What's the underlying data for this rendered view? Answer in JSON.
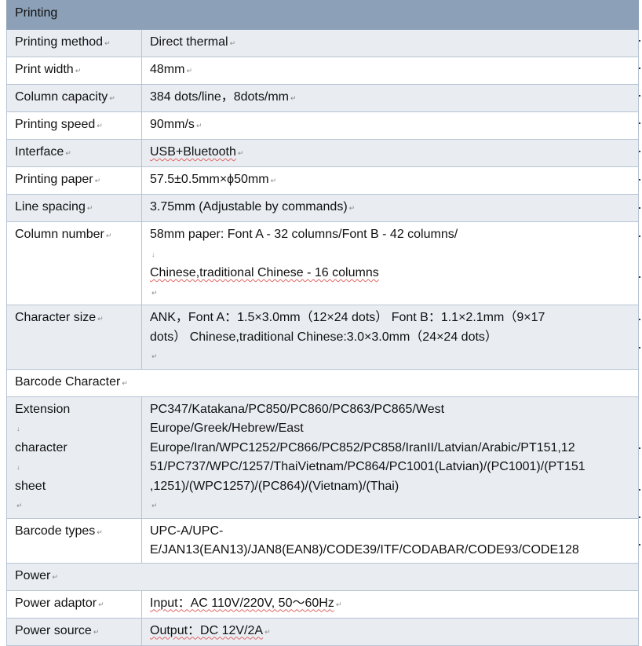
{
  "header": {
    "title": "Printing",
    "mark": "↵"
  },
  "rows": [
    {
      "label": "Printing method",
      "value": [
        "Direct thermal"
      ]
    },
    {
      "label": "Print width",
      "value": [
        "48mm"
      ]
    },
    {
      "label": "Column capacity",
      "value": [
        "384 dots/line，8dots/mm"
      ]
    },
    {
      "label": "Printing speed",
      "value": [
        "90mm/s"
      ]
    },
    {
      "label": "Interface",
      "value": [
        "USB+Bluetooth"
      ]
    },
    {
      "label": "Printing paper",
      "value": [
        "57.5±0.5mm×ϕ50mm"
      ]
    },
    {
      "label": "Line spacing",
      "value": [
        "3.75mm (Adjustable by commands)"
      ]
    },
    {
      "label": "Column number",
      "value": [
        "58mm paper: Font A - 32 columns/Font B - 42 columns/",
        "Chinese,traditional Chinese - 16 columns"
      ]
    },
    {
      "label": "Character size",
      "value": [
        "ANK，Font A：1.5×3.0mm（12×24 dots） Font B：1.1×2.1mm（9×17",
        "dots） Chinese,traditional Chinese:3.0×3.0mm（24×24 dots）"
      ]
    },
    {
      "section": "Barcode Character"
    },
    {
      "label": [
        "Extension",
        "character",
        "sheet"
      ],
      "value": [
        "PC347/Katakana/PC850/PC860/PC863/PC865/West",
        "Europe/Greek/Hebrew/East",
        "Europe/Iran/WPC1252/PC866/PC852/PC858/IranII/Latvian/Arabic/PT151,12",
        "51/PC737/WPC/1257/ThaiVietnam/PC864/PC1001(Latvian)/(PC1001)/(PT151",
        ",1251)/(WPC1257)/(PC864)/(Vietnam)/(Thai)"
      ]
    },
    {
      "label": "Barcode types",
      "value": [
        "UPC-A/UPC-",
        "E/JAN13(EAN13)/JAN8(EAN8)/CODE39/ITF/CODABAR/CODE93/CODE128"
      ]
    },
    {
      "section": "Power"
    },
    {
      "label": "Power adaptor",
      "value": [
        "Input：AC 110V/220V, 50～60Hz"
      ]
    },
    {
      "label": "Power source",
      "value": [
        "Output：DC 12V/2A"
      ]
    }
  ]
}
